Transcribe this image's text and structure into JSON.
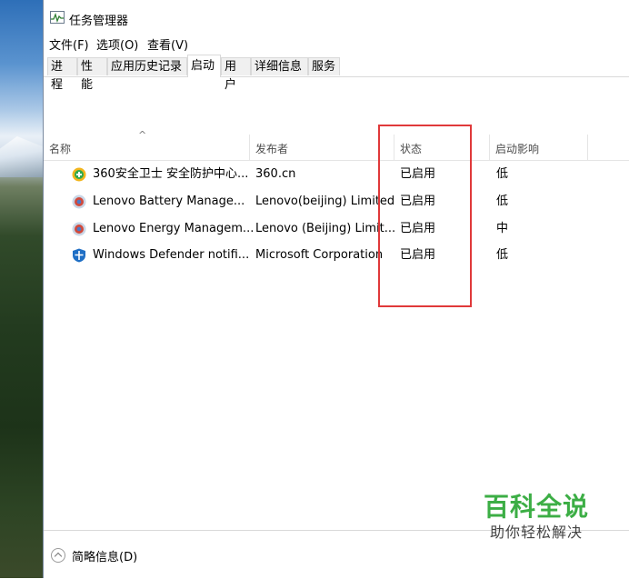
{
  "window": {
    "title": "任务管理器"
  },
  "menu": [
    "文件(F)",
    "选项(O)",
    "查看(V)"
  ],
  "tabs": [
    "进程",
    "性能",
    "应用历史记录",
    "启动",
    "用户",
    "详细信息",
    "服务"
  ],
  "active_tab": "启动",
  "columns": {
    "name": "名称",
    "publisher": "发布者",
    "status": "状态",
    "impact": "启动影响"
  },
  "rows": [
    {
      "icon": "shield-360-icon",
      "name": "360安全卫士 安全防护中心...",
      "publisher": "360.cn",
      "status": "已启用",
      "impact": "低"
    },
    {
      "icon": "lenovo-app-icon",
      "name": "Lenovo Battery Manage...",
      "publisher": "Lenovo(beijing) Limited",
      "status": "已启用",
      "impact": "低"
    },
    {
      "icon": "lenovo-app-icon",
      "name": "Lenovo Energy Managem...",
      "publisher": "Lenovo (Beijing) Limit...",
      "status": "已启用",
      "impact": "中"
    },
    {
      "icon": "windows-defender-icon",
      "name": "Windows Defender notifi...",
      "publisher": "Microsoft Corporation",
      "status": "已启用",
      "impact": "低"
    }
  ],
  "footer": {
    "fewer_details": "简略信息(D)"
  },
  "watermark": {
    "main": "百科全说",
    "sub": "助你轻松解决"
  },
  "colors": {
    "highlight": "#e0393a",
    "watermark_green": "#3cae45"
  }
}
